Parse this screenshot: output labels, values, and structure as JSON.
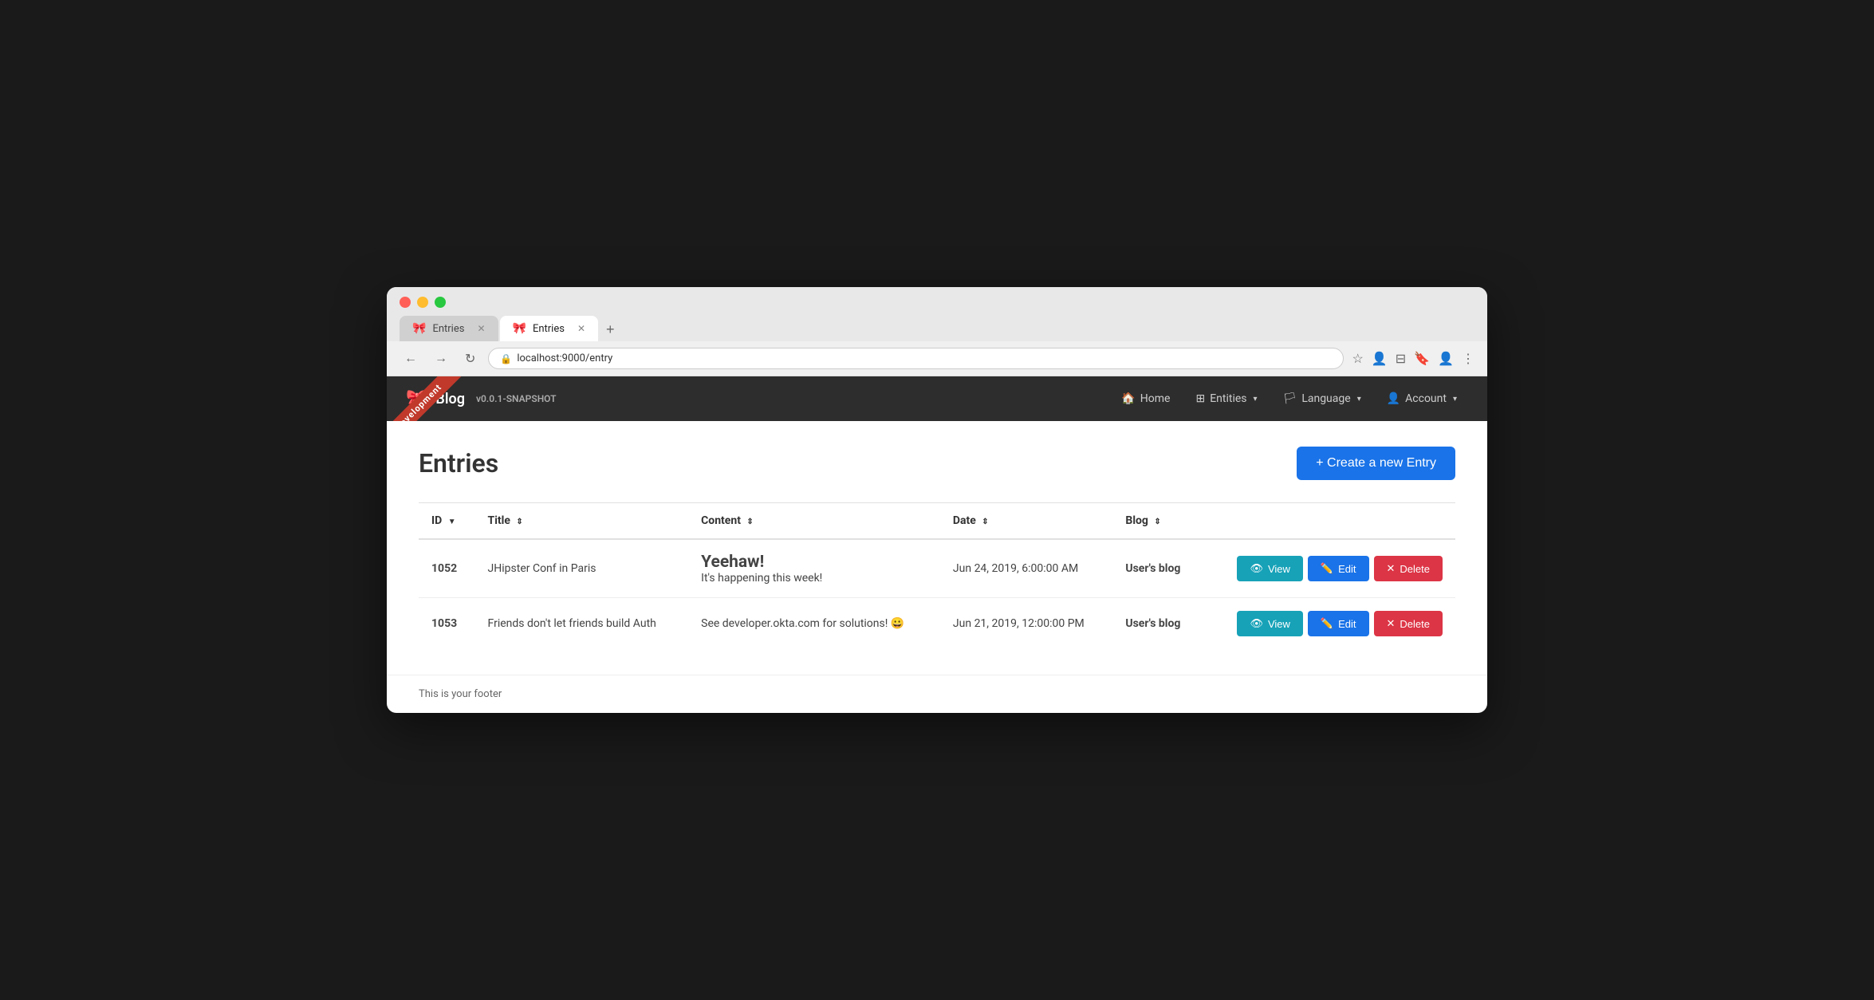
{
  "browser": {
    "url": "localhost:9000/entry",
    "tabs": [
      {
        "label": "Entries",
        "active": false
      },
      {
        "label": "Entries",
        "active": true
      }
    ]
  },
  "nav": {
    "brand": "Blog",
    "version": "v0.0.1-SNAPSHOT",
    "ribbon": "Development",
    "items": [
      {
        "label": "Home",
        "icon": "🏠"
      },
      {
        "label": "Entities",
        "icon": "⊞",
        "hasDropdown": true
      },
      {
        "label": "Language",
        "icon": "🏳",
        "hasDropdown": true
      },
      {
        "label": "Account",
        "icon": "👤",
        "hasDropdown": true
      }
    ]
  },
  "page": {
    "title": "Entries",
    "create_button": "+ Create a new Entry"
  },
  "table": {
    "columns": [
      {
        "label": "ID",
        "sort": "▼"
      },
      {
        "label": "Title",
        "sort": "⇕"
      },
      {
        "label": "Content",
        "sort": "⇕"
      },
      {
        "label": "Date",
        "sort": "⇕"
      },
      {
        "label": "Blog",
        "sort": "⇕"
      }
    ],
    "rows": [
      {
        "id": "1052",
        "title": "JHipster Conf in Paris",
        "content": "<h2>Yeehaw!</h2> It's happening this week!",
        "date": "Jun 24, 2019, 6:00:00 AM",
        "blog": "User's blog"
      },
      {
        "id": "1053",
        "title": "Friends don't let friends build Auth",
        "content": "See developer.okta.com for solutions! 😀",
        "date": "Jun 21, 2019, 12:00:00 PM",
        "blog": "User's blog"
      }
    ],
    "actions": {
      "view": "View",
      "edit": "Edit",
      "delete": "Delete"
    }
  },
  "footer": {
    "text": "This is your footer"
  }
}
